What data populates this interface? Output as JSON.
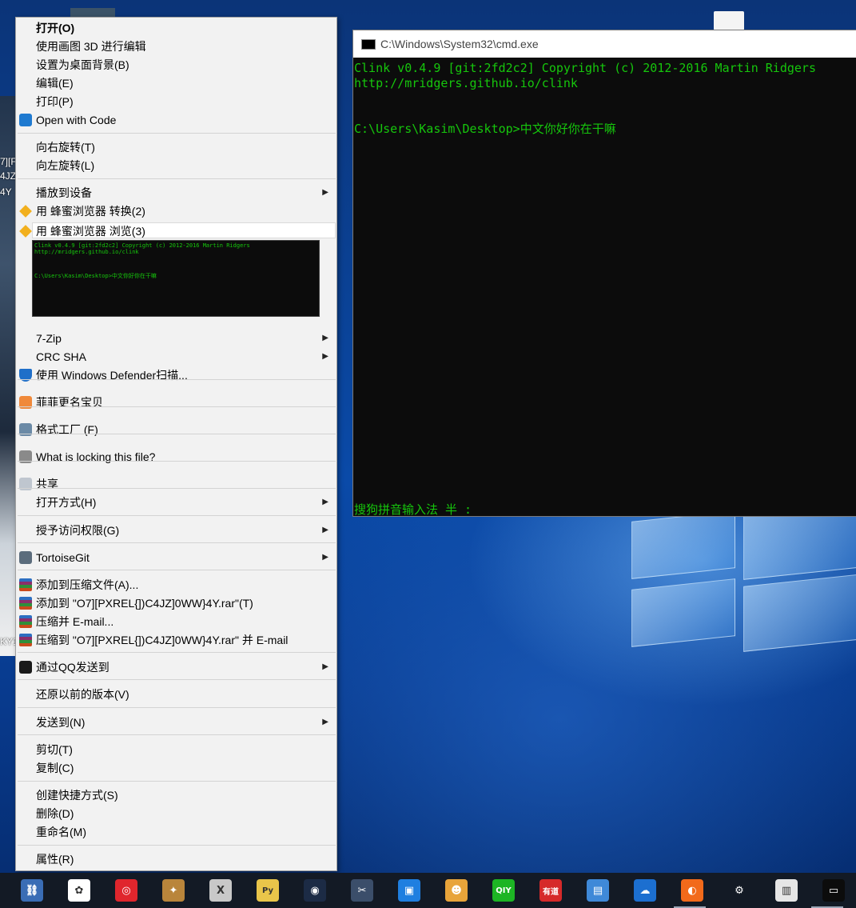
{
  "context_menu": {
    "items": [
      {
        "label": "打开(O)",
        "bold": true
      },
      {
        "label": "使用画图 3D 进行编辑"
      },
      {
        "label": "设置为桌面背景(B)"
      },
      {
        "label": "编辑(E)"
      },
      {
        "label": "打印(P)"
      },
      {
        "label": "Open with Code",
        "icon": "vscode-icon"
      },
      {
        "label": "向右旋转(T)"
      },
      {
        "label": "向左旋转(L)"
      },
      {
        "label": "播放到设备",
        "submenu": true
      },
      {
        "label": "用 蜂蜜浏览器 转换(2)",
        "icon": "honey-browser-icon"
      },
      {
        "label": "用 蜂蜜浏览器 浏览(3)",
        "icon": "honey-browser-icon"
      },
      {
        "label": "7-Zip",
        "submenu": true
      },
      {
        "label": "CRC SHA",
        "submenu": true
      },
      {
        "label": "使用 Windows Defender扫描...",
        "icon": "windows-defender-icon"
      },
      {
        "label": "菲菲更名宝贝",
        "icon": "rename-tool-icon"
      },
      {
        "label": "格式工厂 (F)",
        "icon": "format-factory-icon"
      },
      {
        "label": "What is locking this file?",
        "icon": "lock-search-icon"
      },
      {
        "label": "共享",
        "icon": "share-icon"
      },
      {
        "label": "打开方式(H)",
        "submenu": true
      },
      {
        "label": "授予访问权限(G)",
        "submenu": true
      },
      {
        "label": "TortoiseGit",
        "icon": "tortoisegit-icon",
        "submenu": true
      },
      {
        "label": "添加到压缩文件(A)...",
        "icon": "winrar-icon"
      },
      {
        "label": "添加到 \"O7][PXREL{])C4JZ]0WW}4Y.rar\"(T)",
        "icon": "winrar-icon"
      },
      {
        "label": "压缩并 E-mail...",
        "icon": "winrar-icon"
      },
      {
        "label": "压缩到 \"O7][PXREL{])C4JZ]0WW}4Y.rar\" 并 E-mail",
        "icon": "winrar-icon"
      },
      {
        "label": "通过QQ发送到",
        "icon": "qq-icon",
        "submenu": true
      },
      {
        "label": "还原以前的版本(V)"
      },
      {
        "label": "发送到(N)",
        "submenu": true
      },
      {
        "label": "剪切(T)"
      },
      {
        "label": "复制(C)"
      },
      {
        "label": "创建快捷方式(S)"
      },
      {
        "label": "删除(D)"
      },
      {
        "label": "重命名(M)"
      },
      {
        "label": "属性(R)"
      }
    ],
    "preview_lines": [
      "Clink v0.4.9 [git:2fd2c2] Copyright (c) 2012-2016 Martin Ridgers",
      "http://mridgers.github.io/clink",
      "",
      "C:\\Users\\Kasim\\Desktop>中文你好你在干嘛"
    ]
  },
  "cmd_window": {
    "title": "C:\\Windows\\System32\\cmd.exe",
    "lines": [
      "Clink v0.4.9 [git:2fd2c2] Copyright (c) 2012-2016 Martin Ridgers",
      "http://mridgers.github.io/clink",
      "",
      "C:\\Users\\Kasim\\Desktop>中文你好你在干嘛"
    ],
    "ime_status": "搜狗拼音输入法 半 :",
    "text_color": "#16c60c"
  },
  "desktop": {
    "labels": [
      "7][F",
      "4JZ",
      "4Y",
      "KY1"
    ]
  },
  "taskbar": {
    "icons": [
      {
        "name": "network-tool-icon",
        "glyph": "⛓",
        "color": "#3a6db5"
      },
      {
        "name": "colorful-app-icon",
        "glyph": "✿",
        "color": "#ffffff"
      },
      {
        "name": "netease-music-icon",
        "glyph": "◎",
        "color": "#e0262d"
      },
      {
        "name": "hearthstone-icon",
        "glyph": "✦",
        "color": "#b9853b"
      },
      {
        "name": "xmind-icon",
        "glyph": "X",
        "color": "#c8c8c8"
      },
      {
        "name": "python-file-icon",
        "glyph": "Py",
        "color": "#e9c54a"
      },
      {
        "name": "steam-icon",
        "glyph": "◉",
        "color": "#1c2b45"
      },
      {
        "name": "snipping-tool-icon",
        "glyph": "✂",
        "color": "#3b4e6a"
      },
      {
        "name": "media-player-icon",
        "glyph": "▣",
        "color": "#1f7fe0"
      },
      {
        "name": "game-mascot-icon",
        "glyph": "☻",
        "color": "#e8a43a"
      },
      {
        "name": "iqiyi-icon",
        "glyph": "QIY",
        "color": "#1db524"
      },
      {
        "name": "youdao-icon",
        "glyph": "有道",
        "color": "#d62a2a"
      },
      {
        "name": "id-card-icon",
        "glyph": "▤",
        "color": "#3f89d8"
      },
      {
        "name": "cloud-download-icon",
        "glyph": "☁",
        "color": "#1c6fd0"
      },
      {
        "name": "browser-orange-icon",
        "glyph": "◐",
        "color": "#f26a1b"
      },
      {
        "name": "settings-gear-icon",
        "glyph": "⚙",
        "color": "#131a25"
      },
      {
        "name": "window-app-icon",
        "glyph": "▥",
        "color": "#e6e6e6"
      },
      {
        "name": "cmd-terminal-icon",
        "glyph": "▭",
        "color": "#0c0c0c"
      }
    ]
  }
}
